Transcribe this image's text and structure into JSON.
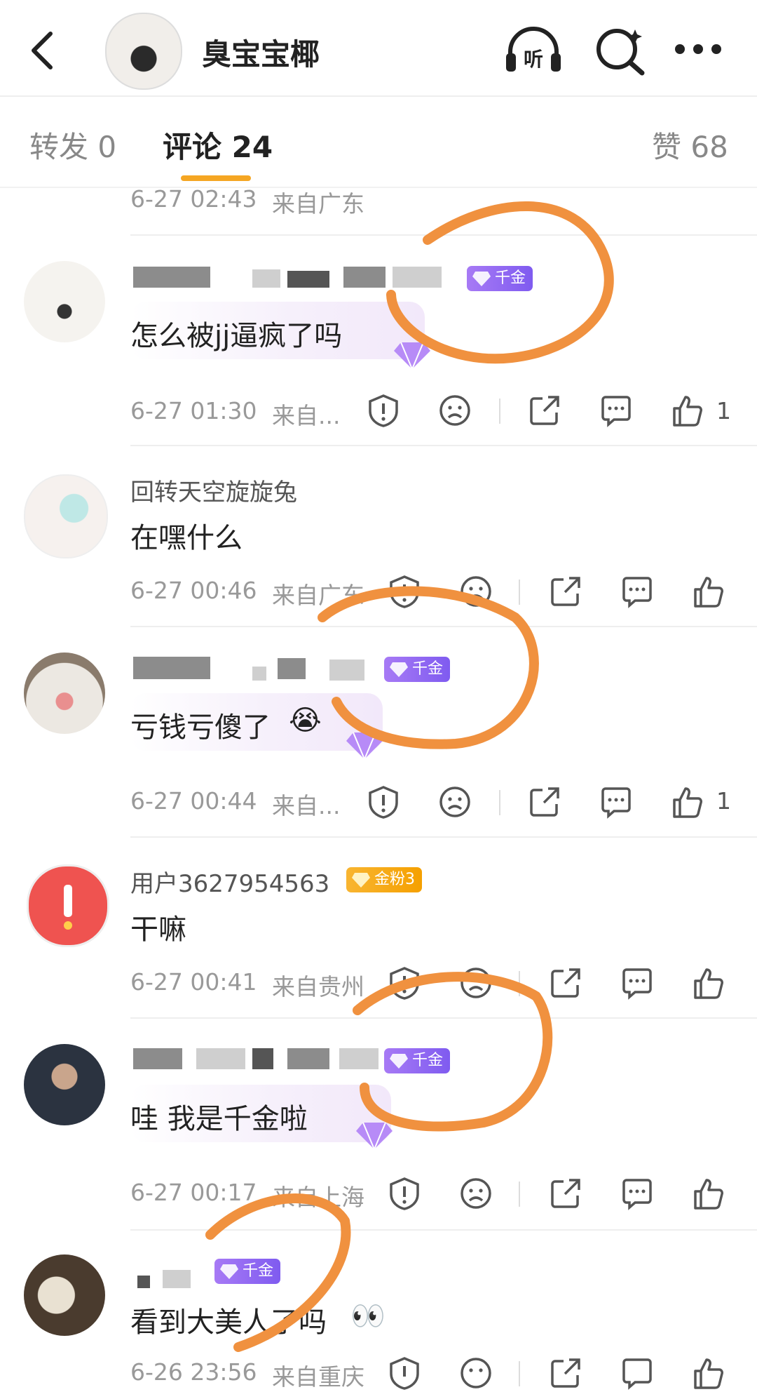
{
  "header": {
    "title": "臭宝宝椰",
    "listen_label": "听"
  },
  "tabs": {
    "repost": "转发 0",
    "comments": "评论 24",
    "likes": "赞 68"
  },
  "comments": [
    {
      "time": "6-27 02:43",
      "location": "来自广东"
    },
    {
      "text": "怎么被jj逼疯了吗",
      "badge": "千金",
      "time": "6-27 01:30",
      "location": "来自...",
      "likes": "1"
    },
    {
      "name": "回转天空旋旋兔",
      "text": "在嘿什么",
      "time": "6-27 00:46",
      "location": "来自广东"
    },
    {
      "text": "亏钱亏傻了",
      "emoji": "😭",
      "badge": "千金",
      "time": "6-27 00:44",
      "location": "来自...",
      "likes": "1"
    },
    {
      "name": "用户3627954563",
      "badge": "金粉3",
      "text": "干嘛",
      "time": "6-27 00:41",
      "location": "来自贵州"
    },
    {
      "text": "哇 我是千金啦",
      "badge": "千金",
      "time": "6-27 00:17",
      "location": "来自上海"
    },
    {
      "text": "看到大美人了吗",
      "emoji": "👀",
      "badge": "千金",
      "time": "6-26 23:56",
      "location": "来自重庆"
    }
  ],
  "colors": {
    "accent": "#f5a623",
    "badge_purple": "#8e67f2",
    "badge_gold": "#f5a000",
    "scribble": "#f0913f"
  }
}
